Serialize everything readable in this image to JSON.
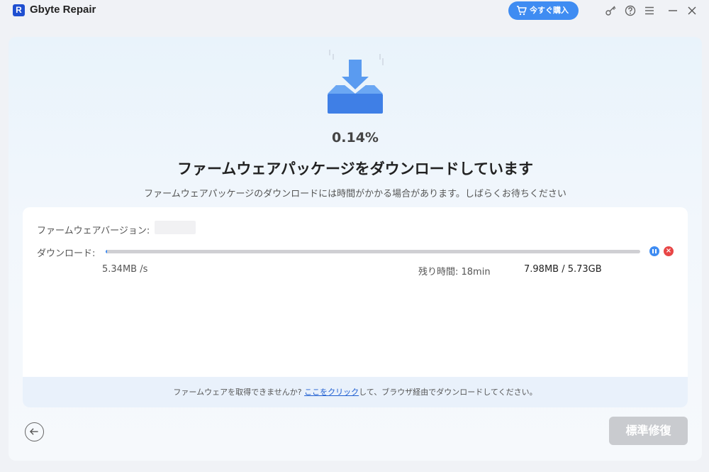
{
  "app": {
    "title": "Gbyte Repair",
    "logo_letter": "R",
    "buy_label": "今すぐ購入",
    "accent_color": "#3f8cf2"
  },
  "titlebar_icons": [
    "key-icon",
    "help-icon",
    "menu-icon",
    "minimize-icon",
    "close-icon"
  ],
  "download": {
    "percent": "0.14%",
    "progress_fraction": 0.0014,
    "heading": "ファームウェアパッケージをダウンロードしています",
    "subtitle": "ファームウェアパッケージのダウンロードには時間がかかる場合があります。しばらくお待ちください",
    "firmware_label": "ファームウェアバージョン:",
    "download_label": "ダウンロード:",
    "speed": "5.34MB /s",
    "remaining": "残り時間: 18min",
    "size": "7.98MB / 5.73GB"
  },
  "notice": {
    "prefix": "ファームウェアを取得できませんか? ",
    "link": "ここをクリック",
    "suffix": "して、ブラウザ経由でダウンロードしてください。"
  },
  "footer": {
    "repair_label": "標準修復"
  }
}
